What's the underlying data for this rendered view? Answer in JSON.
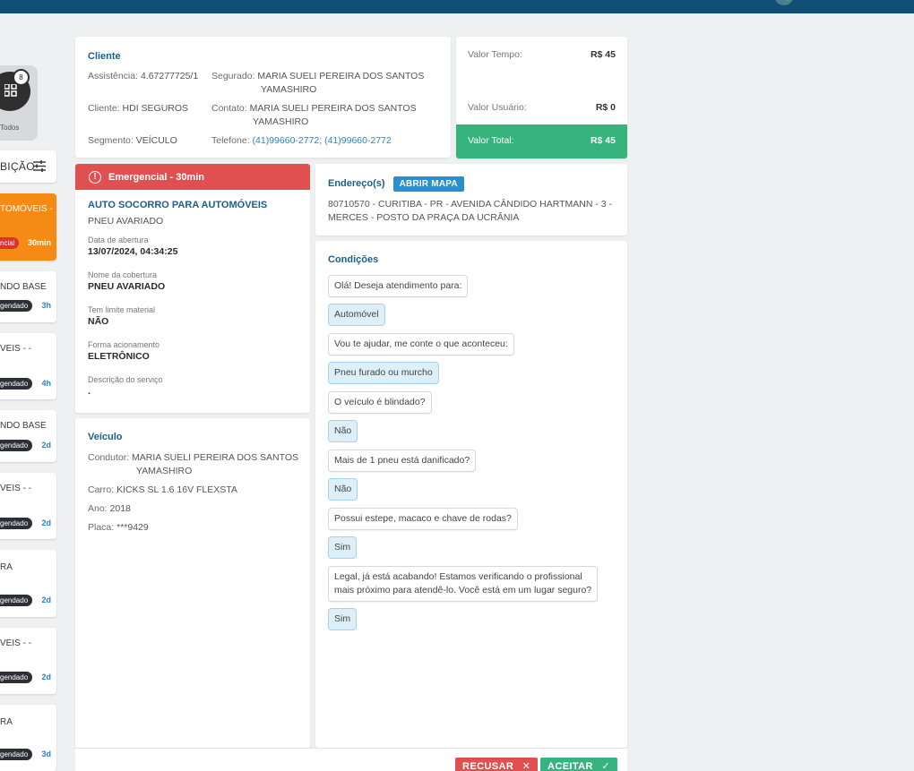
{
  "sidebar": {
    "todos": {
      "label": "Todos",
      "badge": "8"
    },
    "filter": {
      "label": "BIÇÃO"
    },
    "items": [
      {
        "title": "TOMÓVEIS -",
        "status": "ncial",
        "time": "30min"
      },
      {
        "title": "NDO BASE",
        "status": "gendado",
        "time": "3h"
      },
      {
        "title": "VEIS - -",
        "status": "gendado",
        "time": "4h"
      },
      {
        "title": "NDO BASE",
        "status": "gendado",
        "time": "2d"
      },
      {
        "title": "VEIS - -",
        "status": "gendado",
        "time": "2d"
      },
      {
        "title": "RA",
        "status": "gendado",
        "time": "2d"
      },
      {
        "title": "VEIS - -",
        "status": "gendado",
        "time": "2d"
      },
      {
        "title": "RA",
        "status": "gendado",
        "time": "3d"
      }
    ]
  },
  "cliente": {
    "title": "Cliente",
    "assistencia_k": "Assistência:",
    "assistencia_v": "4.67277725/1",
    "cliente_k": "Cliente:",
    "cliente_v": "HDI SEGUROS",
    "segmento_k": "Segmento:",
    "segmento_v": "VEÍCULO",
    "segurado_k": "Segurado:",
    "segurado_v1": "MARIA SUELI PEREIRA DOS SANTOS",
    "segurado_v2": "YAMASHIRO",
    "contato_k": "Contato:",
    "contato_v1": "MARIA SUELI PEREIRA DOS SANTOS",
    "contato_v2": "YAMASHIRO",
    "telefone_k": "Telefone:",
    "telefone_v": "(41)99660-2772; (41)99660-2772"
  },
  "valores": {
    "tempo_l": "Valor Tempo:",
    "tempo_v": "R$ 45",
    "usuario_l": "Valor Usuário:",
    "usuario_v": "R$ 0",
    "total_l": "Valor Total:",
    "total_v": "R$ 45"
  },
  "servico": {
    "urgencia": "Emergencial - 30min",
    "tipo": "AUTO SOCORRO PARA AUTOMÓVEIS",
    "subtipo": "PNEU AVARIADO",
    "fields": [
      {
        "label": "Data de abertura",
        "value": "13/07/2024, 04:34:25"
      },
      {
        "label": "Nome da cobertura",
        "value": "PNEU AVARIADO"
      },
      {
        "label": "Tem limite material",
        "value": "NÃO"
      },
      {
        "label": "Forma acionamento",
        "value": "ELETRÔNICO"
      },
      {
        "label": "Descrição do serviço",
        "value": "."
      }
    ]
  },
  "veiculo": {
    "title": "Veículo",
    "condutor_k": "Condutor:",
    "condutor_v1": "MARIA SUELI PEREIRA DOS SANTOS",
    "condutor_v2": "YAMASHIRO",
    "carro_k": "Carro:",
    "carro_v": "KICKS SL 1.6 16V FLEXSTA",
    "ano_k": "Ano:",
    "ano_v": "2018",
    "placa_k": "Placa:",
    "placa_v": "***9429"
  },
  "endereco": {
    "title": "Endereço(s)",
    "button": "ABRIR MAPA",
    "line1": "80710570 - CURITIBA - PR - AVENIDA CÂNDIDO HARTMANN - 3 -",
    "line2": "MERCES - POSTO DA PRAÇA DA UCRÂNIA"
  },
  "condicoes": {
    "title": "Condições",
    "messages": [
      {
        "type": "q",
        "text": "Olá! Deseja atendimento para:"
      },
      {
        "type": "a",
        "text": "Automóvel"
      },
      {
        "type": "q",
        "text": "Vou te ajudar, me conte o que aconteceu:"
      },
      {
        "type": "a",
        "text": "Pneu furado ou murcho"
      },
      {
        "type": "q",
        "text": "O veículo é blindado?"
      },
      {
        "type": "a",
        "text": "Não"
      },
      {
        "type": "q",
        "text": "Mais de 1 pneu está danificado?"
      },
      {
        "type": "a",
        "text": "Não"
      },
      {
        "type": "q",
        "text": "Possui estepe, macaco e chave de rodas?"
      },
      {
        "type": "a",
        "text": "Sim"
      },
      {
        "type": "q",
        "text": "Legal, já está acabando! Estamos verificando o profissional",
        "text2": "mais próximo para atendê-lo. Você está em um lugar seguro?"
      },
      {
        "type": "a",
        "text": "Sim"
      }
    ]
  },
  "actions": {
    "recusar": "RECUSAR",
    "aceitar": "ACEITAR"
  }
}
